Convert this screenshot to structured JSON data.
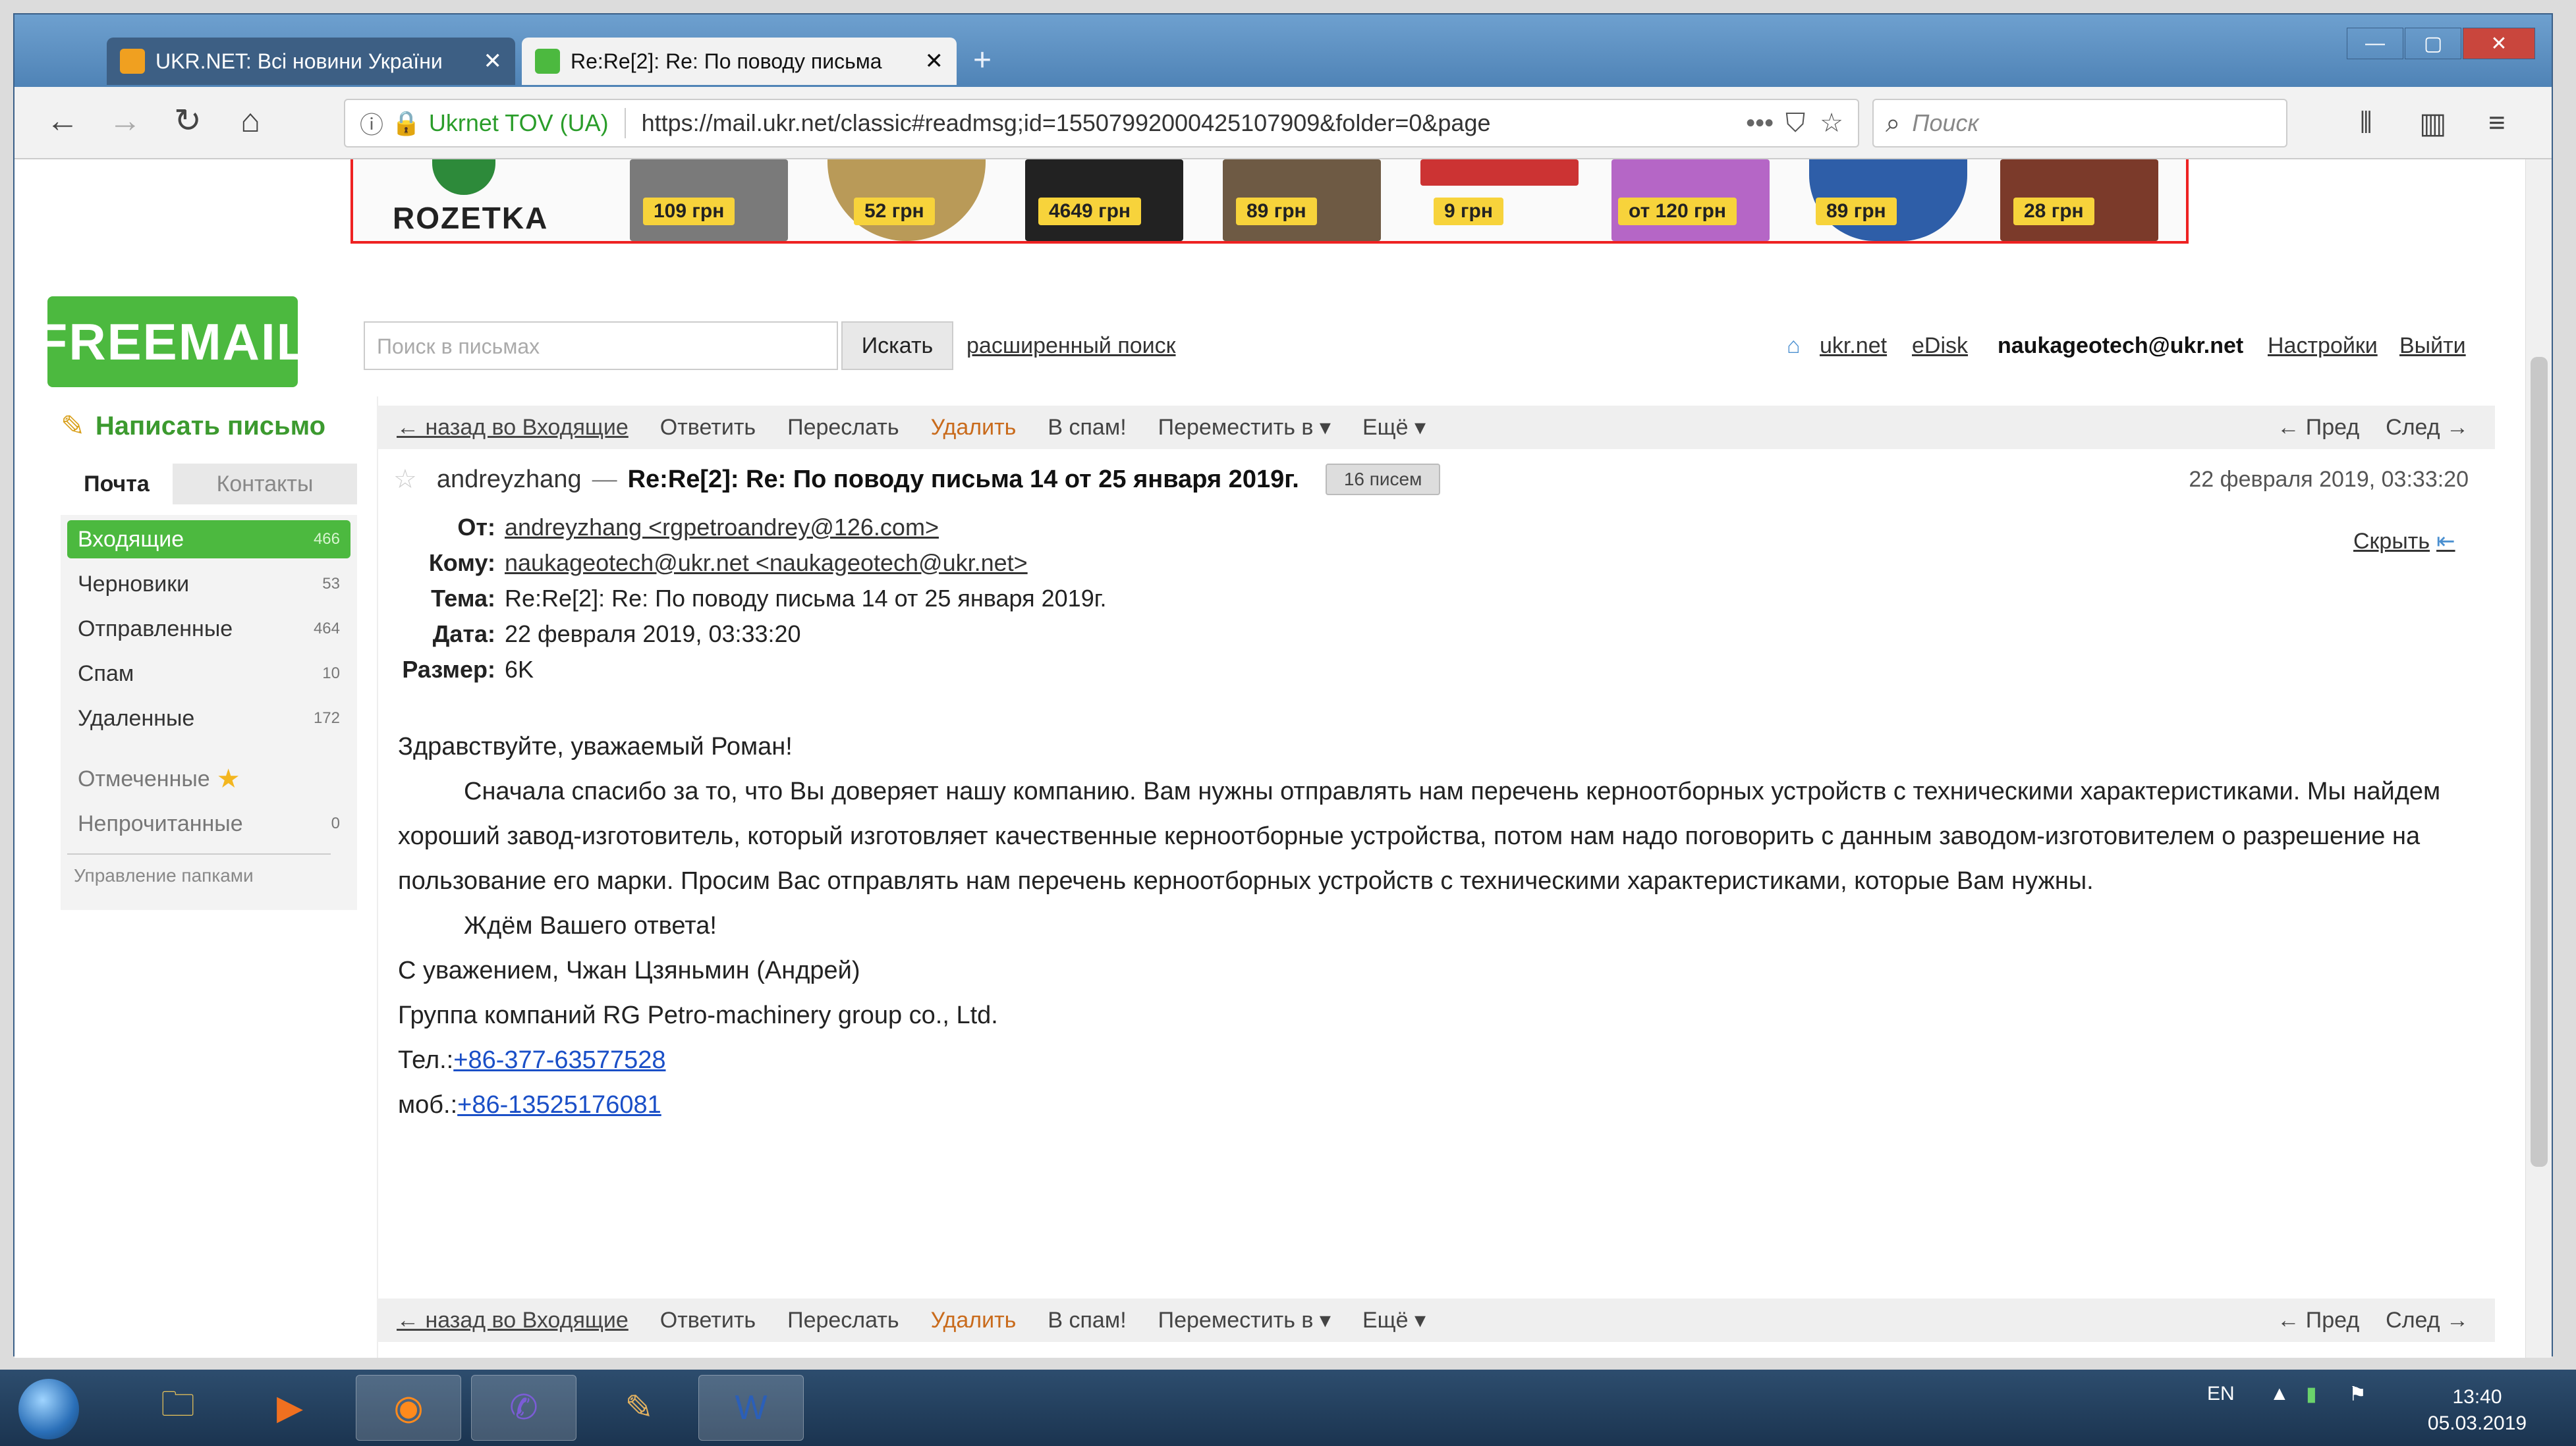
{
  "browser": {
    "tabs": [
      {
        "label": "UKR.NET: Всі новини України"
      },
      {
        "label": "Re:Re[2]: Re: По поводу письма"
      }
    ],
    "new_tab": "+",
    "window_controls": {
      "min": "—",
      "max": "▢",
      "close": "✕"
    },
    "address": {
      "org": "Ukrnet TOV (UA)",
      "url": "https://mail.ukr.net/classic#readmsg;id=15507992000425107909&folder=0&page",
      "more": "•••"
    },
    "search_placeholder": "Поиск"
  },
  "banner": {
    "logo": "ROZETKA",
    "prices": [
      "109 грн",
      "52 грн",
      "4649 грн",
      "89 грн",
      "9 грн",
      "от 120 грн",
      "89 грн",
      "28 грн"
    ]
  },
  "mail": {
    "logo": "FREEMAIL",
    "search_placeholder": "Поиск в письмах",
    "search_button": "Искать",
    "advanced_search": "расширенный поиск",
    "header_links": {
      "ukrnet": "ukr.net",
      "edisk": "eDisk",
      "account": "naukageotech@ukr.net",
      "settings": "Настройки",
      "logout": "Выйти"
    },
    "compose": "Написать письмо",
    "side_tabs": {
      "mail": "Почта",
      "contacts": "Контакты"
    },
    "folders": [
      {
        "label": "Входящие",
        "count": "466"
      },
      {
        "label": "Черновики",
        "count": "53"
      },
      {
        "label": "Отправленные",
        "count": "464"
      },
      {
        "label": "Спам",
        "count": "10"
      },
      {
        "label": "Удаленные",
        "count": "172"
      },
      {
        "label": "Отмеченные",
        "count": ""
      },
      {
        "label": "Непрочитанные",
        "count": "0"
      }
    ],
    "manage_folders": "Управление папками",
    "toolbar": {
      "back": "← назад во Входящие",
      "reply": "Ответить",
      "forward": "Переслать",
      "delete": "Удалить",
      "spam": "В спам!",
      "move": "Переместить в ▾",
      "more": "Ещё ▾",
      "prev": "← Пред",
      "next": "След →"
    },
    "message": {
      "sender_name": "andreyzhang",
      "dash": "—",
      "subject": "Re:Re[2]: Re: По поводу письма 14 от 25 января 2019г.",
      "thread_count": "16 писем",
      "date_top": "22 февраля 2019, 03:33:20",
      "hide": "Скрыть",
      "fields": {
        "from_label": "От:",
        "from": "andreyzhang <rgpetroandrey@126.com>",
        "to_label": "Кому:",
        "to": "naukageotech@ukr.net <naukageotech@ukr.net>",
        "subject_label": "Тема:",
        "subject": "Re:Re[2]: Re: По поводу письма 14 от 25 января 2019г.",
        "date_label": "Дата:",
        "date": "22 февраля 2019, 03:33:20",
        "size_label": "Размер:",
        "size": "6K"
      },
      "body": {
        "greeting": "Здравствуйте, уважаемый Роман!",
        "para": "Сначала спасибо за то, что Вы доверяет нашу компанию. Вам нужны отправлять нам перечень керноотборных устройств с техническими характеристиками. Мы найдем хороший завод-изготовитель, который изготовляет качественные керноотборные устройства, потом нам надо поговорить с данным заводом-изготовителем о разрешение на пользование его марки. Просим Вас отправлять нам перечень керноотборных устройств с техническими характеристиками, которые Вам нужны.",
        "wait": "Ждём Вашего ответа!",
        "regards": "С уважением, Чжан Цзяньмин (Андрей)",
        "company": "Группа компаний RG Petro-machinery group co., Ltd.",
        "tel_label": "Тел.:",
        "tel": "+86-377-63577528",
        "mob_label": "моб.:",
        "mob": "+86-13525176081"
      }
    }
  },
  "taskbar": {
    "lang": "EN",
    "time": "13:40",
    "date": "05.03.2019"
  },
  "colors": {
    "accent_green": "#4cb93f",
    "link_blue": "#1a4fc7",
    "banner_border": "#e22222",
    "price_tag": "#f7d33b"
  }
}
